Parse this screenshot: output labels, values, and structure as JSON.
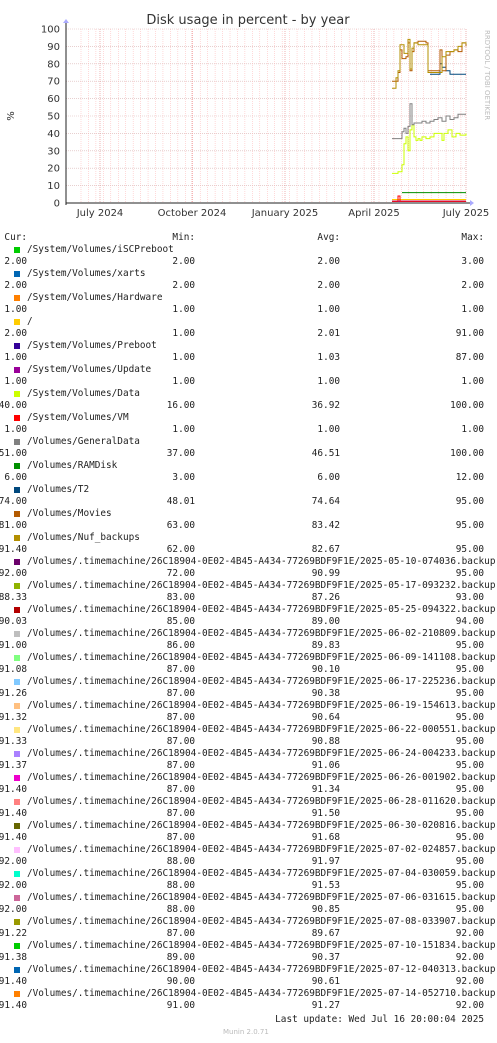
{
  "chart_data": {
    "type": "line",
    "title": "Disk usage in percent - by year",
    "ylabel": "%",
    "ylim": [
      0,
      100
    ],
    "yticks": [
      0,
      10,
      20,
      30,
      40,
      50,
      60,
      70,
      80,
      90,
      100
    ],
    "xlabels": [
      "July 2024",
      "October 2024",
      "January 2025",
      "April 2025",
      "July 2025"
    ],
    "grid": true,
    "series": [
      {
        "name": "/System/Volumes/iSCPreboot",
        "color": "#00cc00",
        "cur": "2.00",
        "min": "2.00",
        "avg": "2.00",
        "max": "3.00",
        "values": [
          [
            0.815,
            2
          ],
          [
            1.0,
            2
          ]
        ]
      },
      {
        "name": "/System/Volumes/xarts",
        "color": "#0066b3",
        "cur": "2.00",
        "min": "2.00",
        "avg": "2.00",
        "max": "2.00",
        "values": [
          [
            0.815,
            2
          ],
          [
            1.0,
            2
          ]
        ]
      },
      {
        "name": "/System/Volumes/Hardware",
        "color": "#ff8000",
        "cur": "1.00",
        "min": "1.00",
        "avg": "1.00",
        "max": "1.00",
        "values": [
          [
            0.815,
            1
          ],
          [
            1.0,
            1
          ]
        ]
      },
      {
        "name": "/",
        "color": "#ffcc00",
        "cur": "2.00",
        "min": "1.00",
        "avg": "2.01",
        "max": "91.00",
        "values": [
          [
            0.815,
            2
          ],
          [
            1.0,
            2
          ]
        ]
      },
      {
        "name": "/System/Volumes/Preboot",
        "color": "#330099",
        "cur": "1.00",
        "min": "1.00",
        "avg": "1.03",
        "max": "87.00",
        "values": [
          [
            0.815,
            1
          ],
          [
            1.0,
            1
          ]
        ]
      },
      {
        "name": "/System/Volumes/Update",
        "color": "#990099",
        "cur": "1.00",
        "min": "1.00",
        "avg": "1.00",
        "max": "1.00",
        "values": [
          [
            0.815,
            1
          ],
          [
            1.0,
            1
          ]
        ]
      },
      {
        "name": "/System/Volumes/Data",
        "color": "#ccff00",
        "cur": "40.00",
        "min": "16.00",
        "avg": "36.92",
        "max": "100.00",
        "values": [
          [
            0.815,
            17
          ],
          [
            0.83,
            18
          ],
          [
            0.835,
            18
          ],
          [
            0.84,
            22
          ],
          [
            0.845,
            34
          ],
          [
            0.85,
            38
          ],
          [
            0.855,
            30
          ],
          [
            0.86,
            42
          ],
          [
            0.865,
            45
          ],
          [
            0.87,
            38
          ],
          [
            0.875,
            36
          ],
          [
            0.88,
            37
          ],
          [
            0.885,
            36
          ],
          [
            0.89,
            38
          ],
          [
            0.9,
            37
          ],
          [
            0.91,
            38
          ],
          [
            0.92,
            40
          ],
          [
            0.93,
            40
          ],
          [
            0.94,
            36
          ],
          [
            0.945,
            40
          ],
          [
            0.955,
            42
          ],
          [
            0.965,
            38
          ],
          [
            0.975,
            40
          ],
          [
            0.985,
            39
          ],
          [
            1.0,
            40
          ]
        ]
      },
      {
        "name": "/System/Volumes/VM",
        "color": "#ff0000",
        "cur": "1.00",
        "min": "1.00",
        "avg": "1.00",
        "max": "1.00",
        "values": [
          [
            0.815,
            1
          ],
          [
            0.83,
            4
          ],
          [
            0.835,
            1
          ],
          [
            1.0,
            1
          ]
        ]
      },
      {
        "name": "/Volumes/GeneralData",
        "color": "#808080",
        "cur": "51.00",
        "min": "37.00",
        "avg": "46.51",
        "max": "100.00",
        "values": [
          [
            0.815,
            37
          ],
          [
            0.83,
            37
          ],
          [
            0.84,
            41
          ],
          [
            0.845,
            43
          ],
          [
            0.85,
            40
          ],
          [
            0.855,
            44
          ],
          [
            0.86,
            57
          ],
          [
            0.865,
            45
          ],
          [
            0.87,
            46
          ],
          [
            0.88,
            46
          ],
          [
            0.89,
            47
          ],
          [
            0.9,
            46
          ],
          [
            0.91,
            47
          ],
          [
            0.92,
            48
          ],
          [
            0.93,
            49
          ],
          [
            0.94,
            47
          ],
          [
            0.95,
            50
          ],
          [
            0.96,
            48
          ],
          [
            0.97,
            49
          ],
          [
            0.98,
            51
          ],
          [
            1.0,
            51
          ]
        ]
      },
      {
        "name": "/Volumes/RAMDisk",
        "color": "#008f00",
        "cur": "6.00",
        "min": "3.00",
        "avg": "6.00",
        "max": "12.00",
        "values": [
          [
            0.84,
            6
          ],
          [
            0.845,
            6
          ],
          [
            0.9,
            6
          ],
          [
            0.92,
            6
          ],
          [
            0.95,
            6
          ],
          [
            1.0,
            6
          ]
        ]
      },
      {
        "name": "/Volumes/T2",
        "color": "#00487d",
        "cur": "74.00",
        "min": "48.01",
        "avg": "74.64",
        "max": "95.00",
        "values": [
          [
            0.91,
            74
          ],
          [
            0.93,
            74
          ],
          [
            0.935,
            80
          ],
          [
            0.94,
            78
          ],
          [
            0.95,
            76
          ],
          [
            0.96,
            74
          ],
          [
            1.0,
            74
          ]
        ]
      },
      {
        "name": "/Volumes/Movies",
        "color": "#b35a00",
        "cur": "81.00",
        "min": "63.00",
        "avg": "83.42",
        "max": "95.00",
        "values": [
          [
            0.815,
            70
          ],
          [
            0.83,
            75
          ],
          [
            0.835,
            88
          ],
          [
            0.84,
            83
          ],
          [
            0.85,
            84
          ],
          [
            0.855,
            92
          ],
          [
            0.86,
            76
          ],
          [
            0.865,
            87
          ],
          [
            0.87,
            92
          ],
          [
            0.88,
            93
          ],
          [
            0.9,
            92
          ],
          [
            0.905,
            76
          ],
          [
            0.93,
            76
          ],
          [
            0.935,
            88
          ],
          [
            0.94,
            76
          ],
          [
            0.95,
            85
          ],
          [
            0.96,
            87
          ],
          [
            0.97,
            88
          ],
          [
            0.98,
            87
          ],
          [
            0.99,
            92
          ],
          [
            1.0,
            90
          ]
        ]
      },
      {
        "name": "/Volumes/Nuf_backups",
        "color": "#b38f00",
        "cur": "91.40",
        "min": "62.00",
        "avg": "82.67",
        "max": "95.00",
        "values": [
          [
            0.815,
            66
          ],
          [
            0.825,
            72
          ],
          [
            0.83,
            76
          ],
          [
            0.835,
            91
          ],
          [
            0.845,
            86
          ],
          [
            0.855,
            94
          ],
          [
            0.86,
            77
          ],
          [
            0.865,
            89
          ],
          [
            0.87,
            92
          ],
          [
            0.88,
            91
          ],
          [
            0.9,
            91
          ],
          [
            0.905,
            75
          ],
          [
            0.93,
            75
          ],
          [
            0.94,
            84
          ],
          [
            0.95,
            87
          ],
          [
            0.97,
            88
          ],
          [
            0.98,
            90
          ],
          [
            0.99,
            92
          ],
          [
            1.0,
            91.4
          ]
        ]
      },
      {
        "name": "/Volumes/.timemachine/26C18904-0E02-4B45-A434-77269BDF9F1E/2025-05-10-074036.backup",
        "color": "#6b006b",
        "cur": "92.00",
        "min": "72.00",
        "avg": "90.99",
        "max": "95.00",
        "values": []
      },
      {
        "name": "/Volumes/.timemachine/26C18904-0E02-4B45-A434-77269BDF9F1E/2025-05-17-093232.backup",
        "color": "#8fb300",
        "cur": "88.33",
        "min": "83.00",
        "avg": "87.26",
        "max": "93.00",
        "values": []
      },
      {
        "name": "/Volumes/.timemachine/26C18904-0E02-4B45-A434-77269BDF9F1E/2025-05-25-094322.backup",
        "color": "#b30000",
        "cur": "90.03",
        "min": "85.00",
        "avg": "89.00",
        "max": "94.00",
        "values": []
      },
      {
        "name": "/Volumes/.timemachine/26C18904-0E02-4B45-A434-77269BDF9F1E/2025-06-02-210809.backup",
        "color": "#bebebe",
        "cur": "91.00",
        "min": "86.00",
        "avg": "89.83",
        "max": "95.00",
        "values": []
      },
      {
        "name": "/Volumes/.timemachine/26C18904-0E02-4B45-A434-77269BDF9F1E/2025-06-09-141108.backup",
        "color": "#80ff80",
        "cur": "91.08",
        "min": "87.00",
        "avg": "90.10",
        "max": "95.00",
        "values": []
      },
      {
        "name": "/Volumes/.timemachine/26C18904-0E02-4B45-A434-77269BDF9F1E/2025-06-17-225236.backup",
        "color": "#80c9ff",
        "cur": "91.26",
        "min": "87.00",
        "avg": "90.38",
        "max": "95.00",
        "values": []
      },
      {
        "name": "/Volumes/.timemachine/26C18904-0E02-4B45-A434-77269BDF9F1E/2025-06-19-154613.backup",
        "color": "#ffc080",
        "cur": "91.32",
        "min": "87.00",
        "avg": "90.64",
        "max": "95.00",
        "values": []
      },
      {
        "name": "/Volumes/.timemachine/26C18904-0E02-4B45-A434-77269BDF9F1E/2025-06-22-000551.backup",
        "color": "#ffe680",
        "cur": "91.33",
        "min": "87.00",
        "avg": "90.88",
        "max": "95.00",
        "values": []
      },
      {
        "name": "/Volumes/.timemachine/26C18904-0E02-4B45-A434-77269BDF9F1E/2025-06-24-004233.backup",
        "color": "#aa80ff",
        "cur": "91.37",
        "min": "87.00",
        "avg": "91.06",
        "max": "95.00",
        "values": []
      },
      {
        "name": "/Volumes/.timemachine/26C18904-0E02-4B45-A434-77269BDF9F1E/2025-06-26-001902.backup",
        "color": "#ee00cc",
        "cur": "91.40",
        "min": "87.00",
        "avg": "91.34",
        "max": "95.00",
        "values": []
      },
      {
        "name": "/Volumes/.timemachine/26C18904-0E02-4B45-A434-77269BDF9F1E/2025-06-28-011620.backup",
        "color": "#ff8080",
        "cur": "91.40",
        "min": "87.00",
        "avg": "91.50",
        "max": "95.00",
        "values": []
      },
      {
        "name": "/Volumes/.timemachine/26C18904-0E02-4B45-A434-77269BDF9F1E/2025-06-30-020816.backup",
        "color": "#666600",
        "cur": "91.40",
        "min": "87.00",
        "avg": "91.68",
        "max": "95.00",
        "values": []
      },
      {
        "name": "/Volumes/.timemachine/26C18904-0E02-4B45-A434-77269BDF9F1E/2025-07-02-024857.backup",
        "color": "#ffbfff",
        "cur": "92.00",
        "min": "88.00",
        "avg": "91.97",
        "max": "95.00",
        "values": []
      },
      {
        "name": "/Volumes/.timemachine/26C18904-0E02-4B45-A434-77269BDF9F1E/2025-07-04-030059.backup",
        "color": "#00ffcc",
        "cur": "92.00",
        "min": "88.00",
        "avg": "91.53",
        "max": "95.00",
        "values": []
      },
      {
        "name": "/Volumes/.timemachine/26C18904-0E02-4B45-A434-77269BDF9F1E/2025-07-06-031615.backup",
        "color": "#cc6699",
        "cur": "92.00",
        "min": "88.00",
        "avg": "90.85",
        "max": "95.00",
        "values": []
      },
      {
        "name": "/Volumes/.timemachine/26C18904-0E02-4B45-A434-77269BDF9F1E/2025-07-08-033907.backup",
        "color": "#999900",
        "cur": "91.22",
        "min": "87.00",
        "avg": "89.67",
        "max": "92.00",
        "values": []
      },
      {
        "name": "/Volumes/.timemachine/26C18904-0E02-4B45-A434-77269BDF9F1E/2025-07-10-151834.backup",
        "color": "#00cc00",
        "cur": "91.38",
        "min": "89.00",
        "avg": "90.37",
        "max": "92.00",
        "values": []
      },
      {
        "name": "/Volumes/.timemachine/26C18904-0E02-4B45-A434-77269BDF9F1E/2025-07-12-040313.backup",
        "color": "#0066b3",
        "cur": "91.40",
        "min": "90.00",
        "avg": "90.61",
        "max": "92.00",
        "values": []
      },
      {
        "name": "/Volumes/.timemachine/26C18904-0E02-4B45-A434-77269BDF9F1E/2025-07-14-052710.backup",
        "color": "#ff8000",
        "cur": "91.40",
        "min": "91.00",
        "avg": "91.27",
        "max": "92.00",
        "values": []
      }
    ]
  },
  "legend_header": {
    "cur": "Cur:",
    "min": "Min:",
    "avg": "Avg:",
    "max": "Max:"
  },
  "side_label": "RRDTOOL / TOBI OETIKER",
  "footer": "Last update: Wed Jul 16 20:00:04 2025",
  "version": "Munin 2.0.71",
  "colors": {
    "grid_minor": "#ffb3b3",
    "grid_major": "#d9b3b3",
    "axis": "#222222"
  }
}
